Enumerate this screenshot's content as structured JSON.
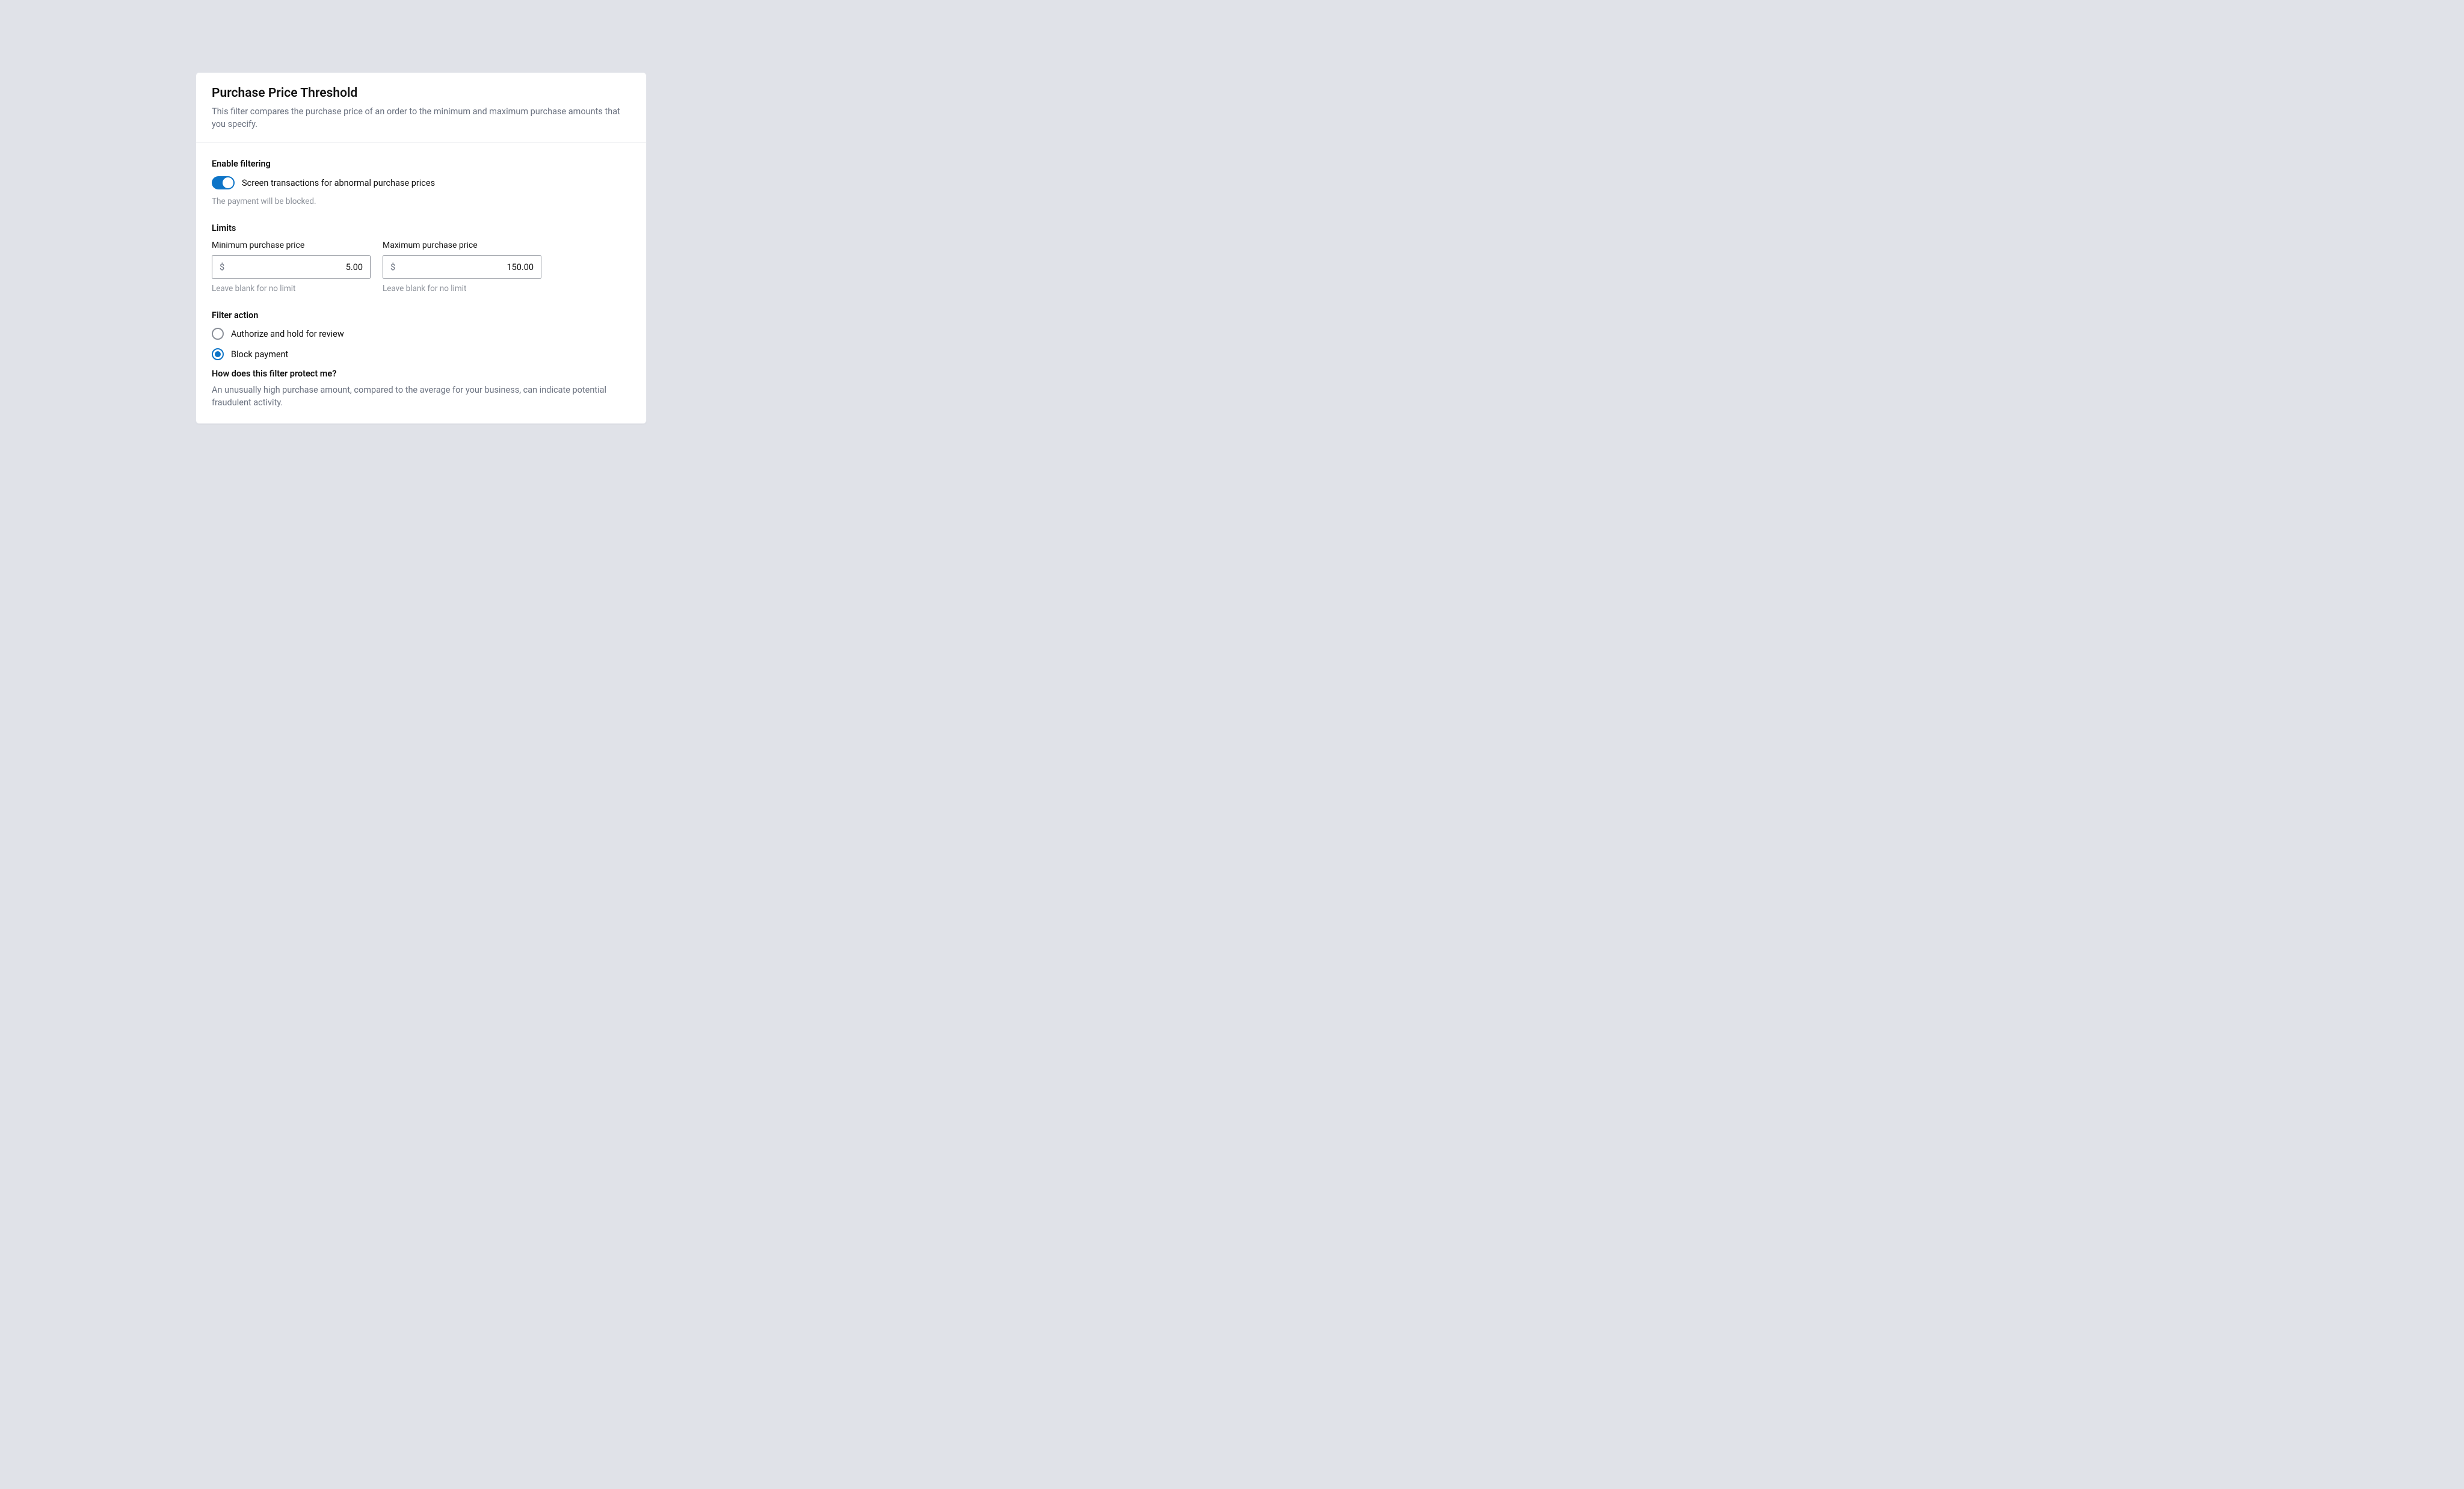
{
  "header": {
    "title": "Purchase Price Threshold",
    "description": "This filter compares the purchase price of an order to the minimum and maximum purchase amounts that you specify."
  },
  "enable": {
    "label": "Enable filtering",
    "toggle_on": true,
    "toggle_text": "Screen transactions for abnormal purchase prices",
    "result_text": "The payment will be blocked."
  },
  "limits": {
    "label": "Limits",
    "min": {
      "label": "Minimum purchase price",
      "prefix": "$",
      "value": "5.00",
      "hint": "Leave blank for no limit"
    },
    "max": {
      "label": "Maximum purchase price",
      "prefix": "$",
      "value": "150.00",
      "hint": "Leave blank for no limit"
    }
  },
  "filter_action": {
    "label": "Filter action",
    "options": [
      {
        "label": "Authorize and hold for review",
        "selected": false
      },
      {
        "label": "Block payment",
        "selected": true
      }
    ]
  },
  "info": {
    "heading": "How does this filter protect me?",
    "body": "An unusually high purchase amount, compared to the average for your business, can indicate potential fraudulent activity."
  },
  "colors": {
    "accent": "#0d74c7",
    "bg": "#e0e2e8",
    "muted": "#8a8f98"
  }
}
